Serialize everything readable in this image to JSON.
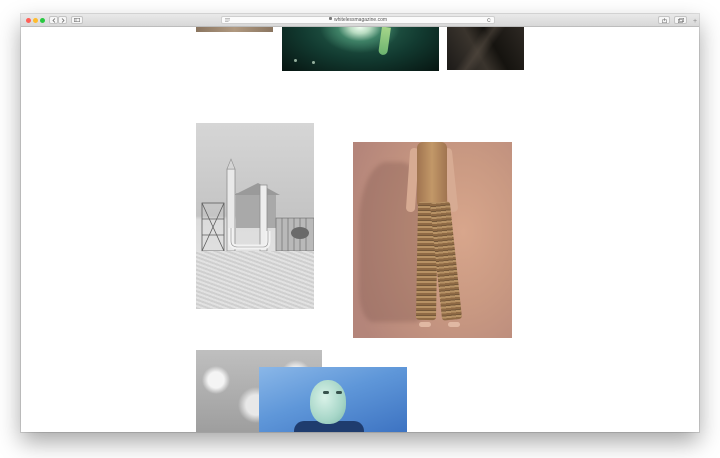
{
  "browser": {
    "address": "whitelessmagazine.com",
    "tab_bar_plus": "+"
  },
  "colors": {
    "traffic_close": "#ff5f57",
    "traffic_minimize": "#febc2e",
    "traffic_maximize": "#28c840",
    "page_background": "#ffffff"
  },
  "toolbar": {
    "icons": [
      "back-icon",
      "forward-icon",
      "sidebar-icon",
      "reader-icon",
      "lock-icon",
      "reload-icon",
      "share-icon",
      "tabs-icon"
    ]
  },
  "gallery": {
    "photos": [
      {
        "id": "photo-strip-top",
        "subject": "brown textured strip"
      },
      {
        "id": "photo-green-light",
        "subject": "green light with finger"
      },
      {
        "id": "photo-dark-texture",
        "subject": "dark fabric texture"
      },
      {
        "id": "photo-industrial-bw",
        "subject": "black and white industrial structure"
      },
      {
        "id": "photo-knit-outfit",
        "subject": "person in knitted outfit"
      },
      {
        "id": "photo-grey-blur",
        "subject": "grey blurred lights"
      },
      {
        "id": "photo-blue-figure",
        "subject": "pale figure against blue"
      }
    ]
  }
}
